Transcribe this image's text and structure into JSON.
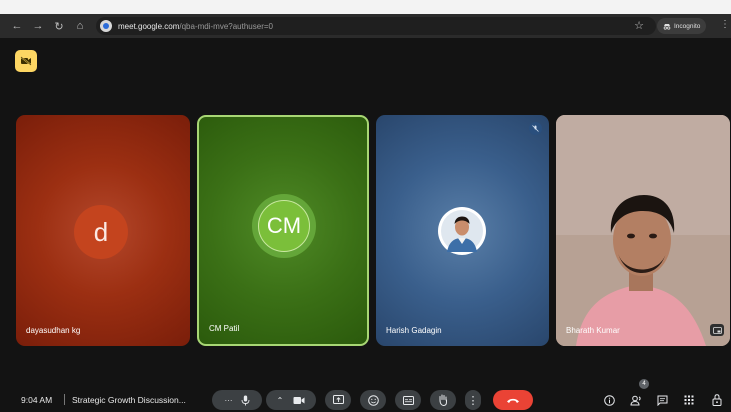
{
  "browser": {
    "url_host": "meet.google.com",
    "url_path": "/qba-mdi-mve?authuser=0",
    "incognito_label": "Incognito"
  },
  "participants": [
    {
      "name": "dayasudhan kg",
      "initial": "d"
    },
    {
      "name": "CM Patil",
      "initial": "CM"
    },
    {
      "name": "Harish Gadagin"
    },
    {
      "name": "Bharath Kumar"
    }
  ],
  "meeting": {
    "time": "9:04 AM",
    "title": "Strategic Growth Discussion..."
  },
  "people_count": "4",
  "colors": {
    "accent_yellow": "#fdd663",
    "end_call_red": "#ea4335",
    "speaking_border": "#a8d774"
  }
}
